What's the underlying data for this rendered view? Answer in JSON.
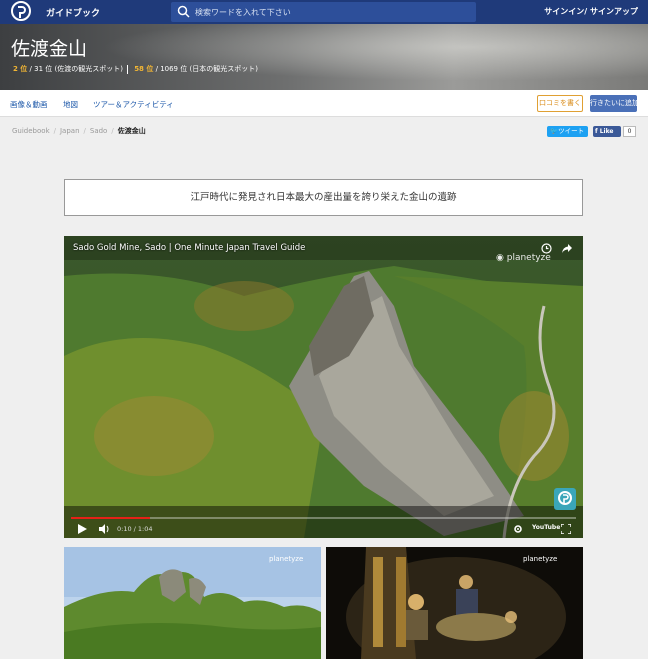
{
  "header": {
    "brand": "ガイドブック",
    "search_placeholder": "検索ワードを入れて下さい",
    "signin": "サインイン/ サインアップ"
  },
  "hero": {
    "title": "佐渡金山",
    "rank1": "2 位",
    "rank1_suffix": "/ 31 位 (佐渡の観光スポット)",
    "rank2": "58 位",
    "rank2_suffix": "/ 1069 位 (日本の観光スポット)"
  },
  "nav": {
    "items": [
      "画像＆動画",
      "地図",
      "ツアー＆アクティビティ"
    ],
    "review_button": "口コミを書く",
    "favorite_button": "行きたいに追加"
  },
  "breadcrumb": [
    "Guidebook",
    "Japan",
    "Sado",
    "佐渡金山"
  ],
  "social": {
    "tweet": "ツイート",
    "like": "Like",
    "like_count": "0"
  },
  "tagline": "江戸時代に発見され日本最大の産出量を誇り栄えた金山の遺跡",
  "video": {
    "title": "Sado Gold Mine, Sado | One Minute Japan Travel Guide",
    "watermark": "planetyze",
    "time": "0:10 / 1:04",
    "progress": 0.156,
    "youtube": "YouTube"
  },
  "thumbnails": [
    {
      "watermark": "planetyze"
    },
    {
      "watermark": "planetyze"
    }
  ],
  "colors": {
    "topbar": "#1f3a7a",
    "accent_orange": "#f2b634",
    "link_blue": "#1a56a8"
  }
}
